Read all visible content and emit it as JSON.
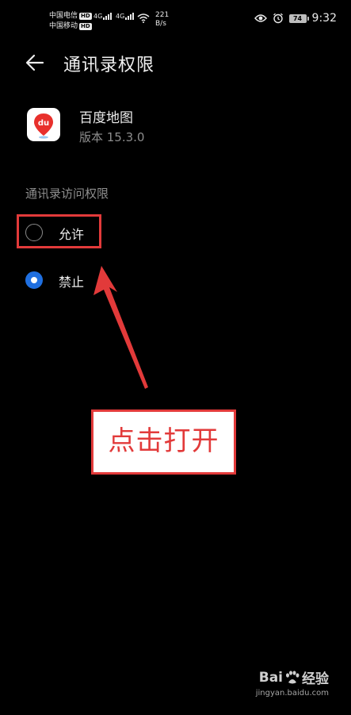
{
  "status_bar": {
    "carrier1": "中国电信",
    "carrier2": "中国移动",
    "hd": "HD",
    "net_type": "4G",
    "speed_value": "221",
    "speed_unit": "B/s",
    "battery": "74",
    "time": "9:32"
  },
  "header": {
    "title": "通讯录权限"
  },
  "app": {
    "name": "百度地图",
    "version": "版本 15.3.0",
    "icon_text": "du"
  },
  "permission": {
    "section_title": "通讯录访问权限",
    "options": [
      {
        "label": "允许",
        "selected": false
      },
      {
        "label": "禁止",
        "selected": true
      }
    ]
  },
  "annotation": {
    "text": "点击打开",
    "color": "#e23a3a"
  },
  "watermark": {
    "brand_left": "Bai",
    "brand_right": "经验",
    "url": "jingyan.baidu.com"
  },
  "colors": {
    "background": "#000000",
    "accent_radio": "#1f6fe0",
    "annotation_red": "#e23a3a"
  }
}
